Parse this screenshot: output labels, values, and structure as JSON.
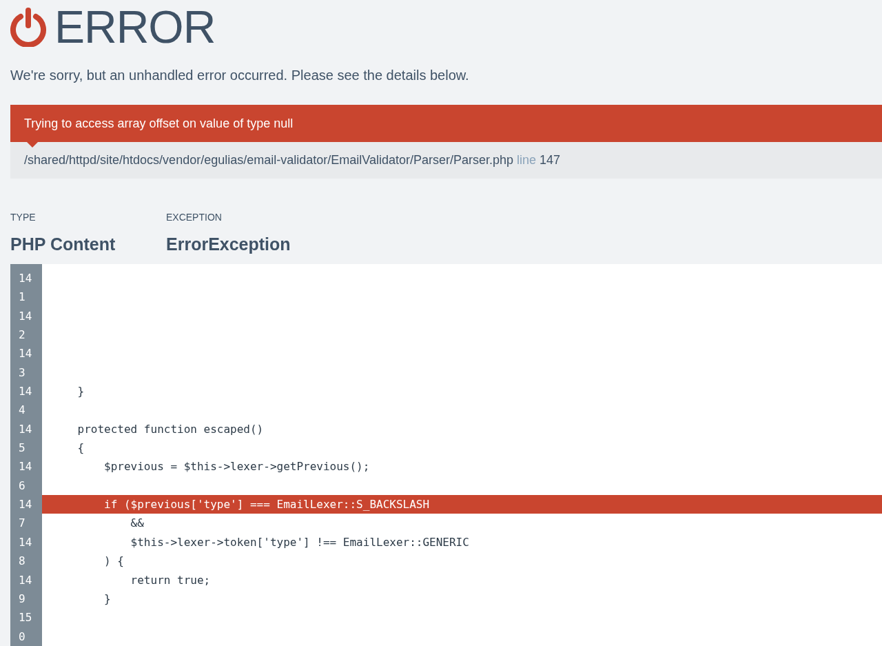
{
  "header": {
    "title": "ERROR"
  },
  "message": "We're sorry, but an unhandled error occurred. Please see the details below.",
  "error": {
    "message": "Trying to access array offset on value of type null",
    "file": "/shared/httpd/site/htdocs/vendor/egulias/email-validator/EmailValidator/Parser/Parser.php",
    "line_label": "line",
    "line": "147"
  },
  "details": [
    {
      "label": "TYPE",
      "value": "PHP Content"
    },
    {
      "label": "EXCEPTION",
      "value": "ErrorException"
    }
  ],
  "code": {
    "line_numbers": [
      "141",
      "142",
      "143",
      "144",
      "145",
      "146",
      "147",
      "148",
      "149",
      "150"
    ],
    "lines": [
      {
        "kind": "blank"
      },
      {
        "kind": "blank"
      },
      {
        "kind": "blank"
      },
      {
        "kind": "blank"
      },
      {
        "kind": "blank"
      },
      {
        "kind": "blank"
      },
      {
        "kind": "code",
        "text": "    }",
        "highlighted": false
      },
      {
        "kind": "blank"
      },
      {
        "kind": "code",
        "text": "    protected function escaped()",
        "highlighted": false
      },
      {
        "kind": "code",
        "text": "    {",
        "highlighted": false
      },
      {
        "kind": "code",
        "text": "        $previous = $this->lexer->getPrevious();",
        "highlighted": false
      },
      {
        "kind": "blank"
      },
      {
        "kind": "code",
        "text": "        if ($previous['type'] === EmailLexer::S_BACKSLASH",
        "highlighted": true
      },
      {
        "kind": "code",
        "text": "            &&",
        "highlighted": false
      },
      {
        "kind": "code",
        "text": "            $this->lexer->token['type'] !== EmailLexer::GENERIC",
        "highlighted": false
      },
      {
        "kind": "code",
        "text": "        ) {",
        "highlighted": false
      },
      {
        "kind": "code",
        "text": "            return true;",
        "highlighted": false
      },
      {
        "kind": "code",
        "text": "        }",
        "highlighted": false
      }
    ]
  }
}
